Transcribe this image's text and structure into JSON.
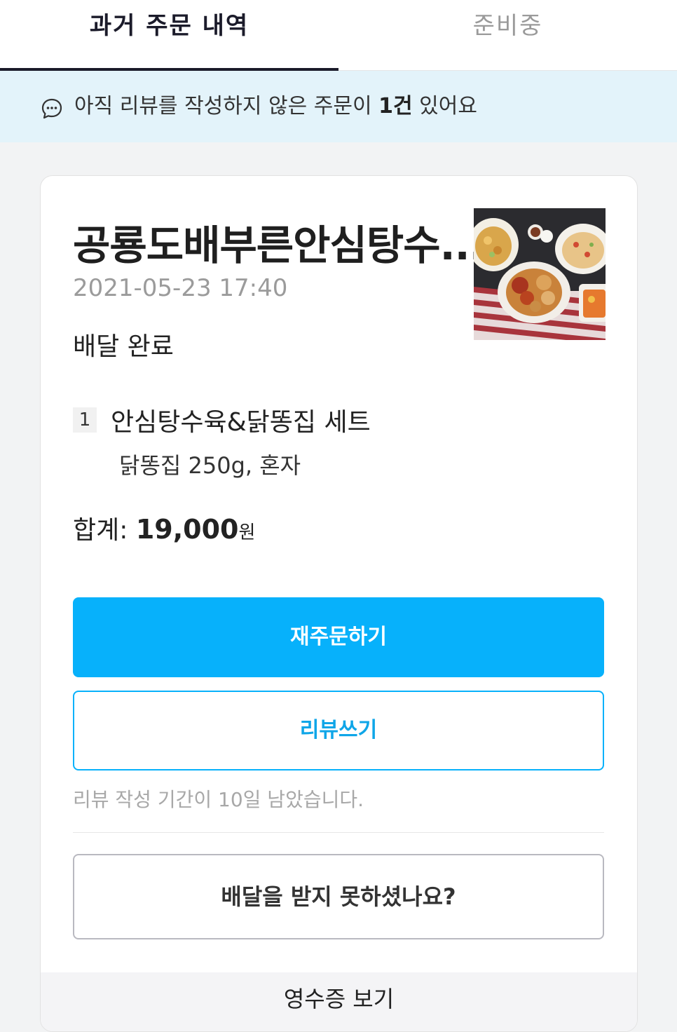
{
  "tabs": {
    "past_orders": "과거 주문 내역",
    "preparing": "준비중"
  },
  "banner": {
    "text_before": "아직 리뷰를 작성하지 않은 주문이 ",
    "count": "1건",
    "text_after": " 있어요",
    "icon": "chat-bubble-icon"
  },
  "order": {
    "store_name": "공룡도배부른안심탕수...",
    "date": "2021-05-23 17:40",
    "status": "배달 완료",
    "thumbnail": "food-photo",
    "item": {
      "quantity": "1",
      "name": "안심탕수육&닭똥집 세트",
      "options": "닭똥집 250g, 혼자"
    },
    "total_label": "합계: ",
    "total_amount": "19,000",
    "total_unit": "원"
  },
  "buttons": {
    "reorder": "재주문하기",
    "write_review": "리뷰쓰기",
    "not_delivered": "배달을 받지 못하셨나요?",
    "receipt": "영수증 보기"
  },
  "review_deadline": "리뷰 작성 기간이 10일 남았습니다.",
  "colors": {
    "accent": "#07b1fb",
    "banner_bg": "#e3f3fa",
    "tab_active": "#1b1b2a"
  }
}
